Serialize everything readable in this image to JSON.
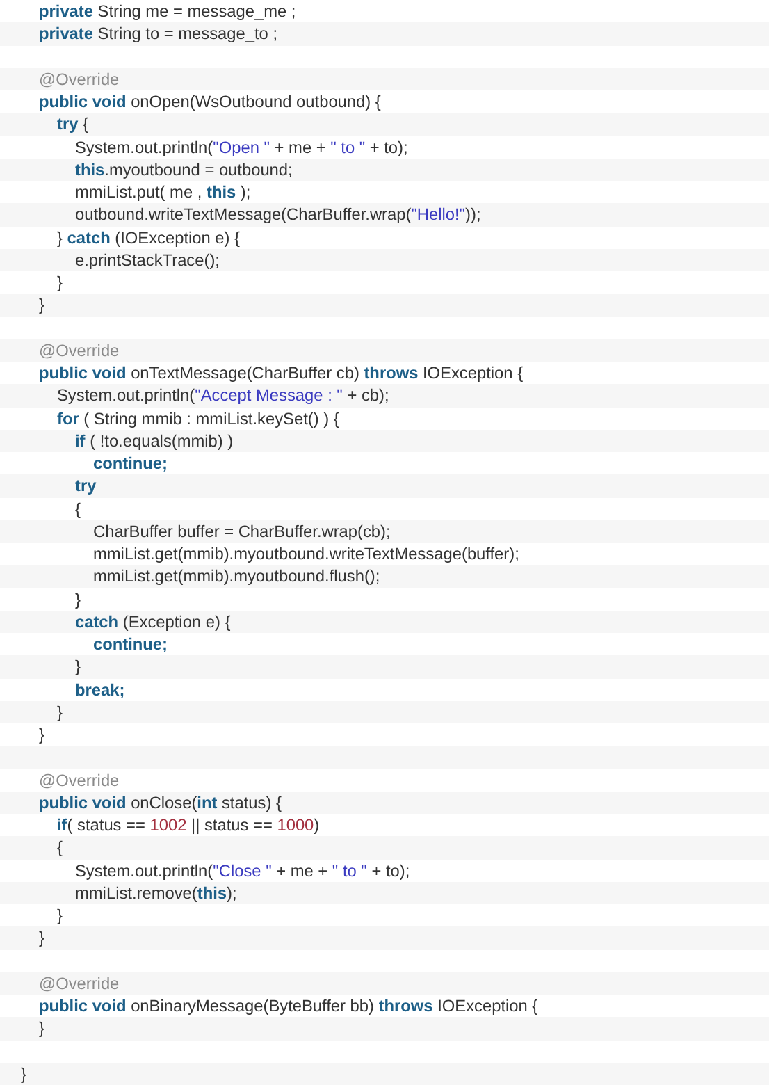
{
  "code_lines": [
    {
      "kind": "code",
      "tokens": [
        {
          "kind": "keyword",
          "text": "\tprivate"
        },
        {
          "kind": "plain",
          "text": " String me = message_me ;"
        }
      ]
    },
    {
      "kind": "code",
      "tokens": [
        {
          "kind": "keyword",
          "text": "\tprivate"
        },
        {
          "kind": "plain",
          "text": " String to = message_to ;"
        }
      ]
    },
    {
      "kind": "blank"
    },
    {
      "kind": "code",
      "tokens": [
        {
          "kind": "annotation",
          "text": "\t@Override"
        }
      ]
    },
    {
      "kind": "code",
      "tokens": [
        {
          "kind": "keyword",
          "text": "\tpublic void"
        },
        {
          "kind": "plain",
          "text": " onOpen(WsOutbound outbound) {"
        }
      ]
    },
    {
      "kind": "code",
      "tokens": [
        {
          "kind": "keyword",
          "text": "\t\ttry"
        },
        {
          "kind": "plain",
          "text": " {"
        }
      ]
    },
    {
      "kind": "code",
      "tokens": [
        {
          "kind": "plain",
          "text": "\t\t\tSystem.out.println("
        },
        {
          "kind": "string",
          "text": "\"Open \""
        },
        {
          "kind": "plain",
          "text": " + me + "
        },
        {
          "kind": "string",
          "text": "\" to \""
        },
        {
          "kind": "plain",
          "text": " + to);"
        }
      ]
    },
    {
      "kind": "code",
      "tokens": [
        {
          "kind": "keyword",
          "text": "\t\t\tthis"
        },
        {
          "kind": "plain",
          "text": ".myoutbound = outbound;"
        }
      ]
    },
    {
      "kind": "code",
      "tokens": [
        {
          "kind": "plain",
          "text": "\t\t\tmmiList.put( me , "
        },
        {
          "kind": "keyword",
          "text": "this"
        },
        {
          "kind": "plain",
          "text": " );"
        }
      ]
    },
    {
      "kind": "code",
      "tokens": [
        {
          "kind": "plain",
          "text": "\t\t\toutbound.writeTextMessage(CharBuffer.wrap("
        },
        {
          "kind": "string",
          "text": "\"Hello!\""
        },
        {
          "kind": "plain",
          "text": "));"
        }
      ]
    },
    {
      "kind": "code",
      "tokens": [
        {
          "kind": "plain",
          "text": "\t\t} "
        },
        {
          "kind": "keyword",
          "text": "catch"
        },
        {
          "kind": "plain",
          "text": " (IOException e) {"
        }
      ]
    },
    {
      "kind": "code",
      "tokens": [
        {
          "kind": "plain",
          "text": "\t\t\te.printStackTrace();"
        }
      ]
    },
    {
      "kind": "code",
      "tokens": [
        {
          "kind": "plain",
          "text": "\t\t}"
        }
      ]
    },
    {
      "kind": "code",
      "tokens": [
        {
          "kind": "plain",
          "text": "\t}"
        }
      ]
    },
    {
      "kind": "blank"
    },
    {
      "kind": "code",
      "tokens": [
        {
          "kind": "annotation",
          "text": "\t@Override"
        }
      ]
    },
    {
      "kind": "code",
      "tokens": [
        {
          "kind": "keyword",
          "text": "\tpublic void"
        },
        {
          "kind": "plain",
          "text": " onTextMessage(CharBuffer cb) "
        },
        {
          "kind": "keyword",
          "text": "throws"
        },
        {
          "kind": "plain",
          "text": " IOException {"
        }
      ]
    },
    {
      "kind": "code",
      "tokens": [
        {
          "kind": "plain",
          "text": "\t\tSystem.out.println("
        },
        {
          "kind": "string",
          "text": "\"Accept Message : \""
        },
        {
          "kind": "plain",
          "text": " + cb);"
        }
      ]
    },
    {
      "kind": "code",
      "tokens": [
        {
          "kind": "keyword",
          "text": "\t\tfor"
        },
        {
          "kind": "plain",
          "text": " ( String mmib : mmiList.keySet() ) {"
        }
      ]
    },
    {
      "kind": "code",
      "tokens": [
        {
          "kind": "keyword",
          "text": "\t\t\tif"
        },
        {
          "kind": "plain",
          "text": " ( !to.equals(mmib) )"
        }
      ]
    },
    {
      "kind": "code",
      "tokens": [
        {
          "kind": "keyword",
          "text": "\t\t\t\tcontinue;"
        }
      ]
    },
    {
      "kind": "code",
      "tokens": [
        {
          "kind": "keyword",
          "text": "\t\t\ttry"
        }
      ]
    },
    {
      "kind": "code",
      "tokens": [
        {
          "kind": "plain",
          "text": "\t\t\t{"
        }
      ]
    },
    {
      "kind": "code",
      "tokens": [
        {
          "kind": "plain",
          "text": "\t\t\t\tCharBuffer buffer = CharBuffer.wrap(cb);"
        }
      ]
    },
    {
      "kind": "code",
      "tokens": [
        {
          "kind": "plain",
          "text": "\t\t\t\tmmiList.get(mmib).myoutbound.writeTextMessage(buffer);"
        }
      ]
    },
    {
      "kind": "code",
      "tokens": [
        {
          "kind": "plain",
          "text": "\t\t\t\tmmiList.get(mmib).myoutbound.flush();"
        }
      ]
    },
    {
      "kind": "code",
      "tokens": [
        {
          "kind": "plain",
          "text": "\t\t\t}"
        }
      ]
    },
    {
      "kind": "code",
      "tokens": [
        {
          "kind": "keyword",
          "text": "\t\t\tcatch"
        },
        {
          "kind": "plain",
          "text": " (Exception e) {"
        }
      ]
    },
    {
      "kind": "code",
      "tokens": [
        {
          "kind": "keyword",
          "text": "\t\t\t\tcontinue;"
        }
      ]
    },
    {
      "kind": "code",
      "tokens": [
        {
          "kind": "plain",
          "text": "\t\t\t}"
        }
      ]
    },
    {
      "kind": "code",
      "tokens": [
        {
          "kind": "keyword",
          "text": "\t\t\tbreak;"
        }
      ]
    },
    {
      "kind": "code",
      "tokens": [
        {
          "kind": "plain",
          "text": "\t\t}"
        }
      ]
    },
    {
      "kind": "code",
      "tokens": [
        {
          "kind": "plain",
          "text": "\t}"
        }
      ]
    },
    {
      "kind": "blank"
    },
    {
      "kind": "code",
      "tokens": [
        {
          "kind": "annotation",
          "text": "\t@Override"
        }
      ]
    },
    {
      "kind": "code",
      "tokens": [
        {
          "kind": "keyword",
          "text": "\tpublic void"
        },
        {
          "kind": "plain",
          "text": " onClose("
        },
        {
          "kind": "keyword",
          "text": "int"
        },
        {
          "kind": "plain",
          "text": " status) {"
        }
      ]
    },
    {
      "kind": "code",
      "tokens": [
        {
          "kind": "keyword",
          "text": "\t\tif"
        },
        {
          "kind": "plain",
          "text": "( status == "
        },
        {
          "kind": "number",
          "text": "1002"
        },
        {
          "kind": "plain",
          "text": " || status == "
        },
        {
          "kind": "number",
          "text": "1000"
        },
        {
          "kind": "plain",
          "text": ")"
        }
      ]
    },
    {
      "kind": "code",
      "tokens": [
        {
          "kind": "plain",
          "text": "\t\t{"
        }
      ]
    },
    {
      "kind": "code",
      "tokens": [
        {
          "kind": "plain",
          "text": "\t\t\tSystem.out.println("
        },
        {
          "kind": "string",
          "text": "\"Close \""
        },
        {
          "kind": "plain",
          "text": " + me + "
        },
        {
          "kind": "string",
          "text": "\" to \""
        },
        {
          "kind": "plain",
          "text": " + to);"
        }
      ]
    },
    {
      "kind": "code",
      "tokens": [
        {
          "kind": "plain",
          "text": "\t\t\tmmiList.remove("
        },
        {
          "kind": "keyword",
          "text": "this"
        },
        {
          "kind": "plain",
          "text": ");"
        }
      ]
    },
    {
      "kind": "code",
      "tokens": [
        {
          "kind": "plain",
          "text": "\t\t}"
        }
      ]
    },
    {
      "kind": "code",
      "tokens": [
        {
          "kind": "plain",
          "text": "\t}"
        }
      ]
    },
    {
      "kind": "blank"
    },
    {
      "kind": "code",
      "tokens": [
        {
          "kind": "annotation",
          "text": "\t@Override"
        }
      ]
    },
    {
      "kind": "code",
      "tokens": [
        {
          "kind": "keyword",
          "text": "\tpublic void"
        },
        {
          "kind": "plain",
          "text": " onBinaryMessage(ByteBuffer bb) "
        },
        {
          "kind": "keyword",
          "text": "throws"
        },
        {
          "kind": "plain",
          "text": " IOException {"
        }
      ]
    },
    {
      "kind": "code",
      "tokens": [
        {
          "kind": "plain",
          "text": "\t}"
        }
      ]
    },
    {
      "kind": "blank"
    },
    {
      "kind": "code",
      "tokens": [
        {
          "kind": "plain",
          "text": "}"
        }
      ]
    }
  ]
}
